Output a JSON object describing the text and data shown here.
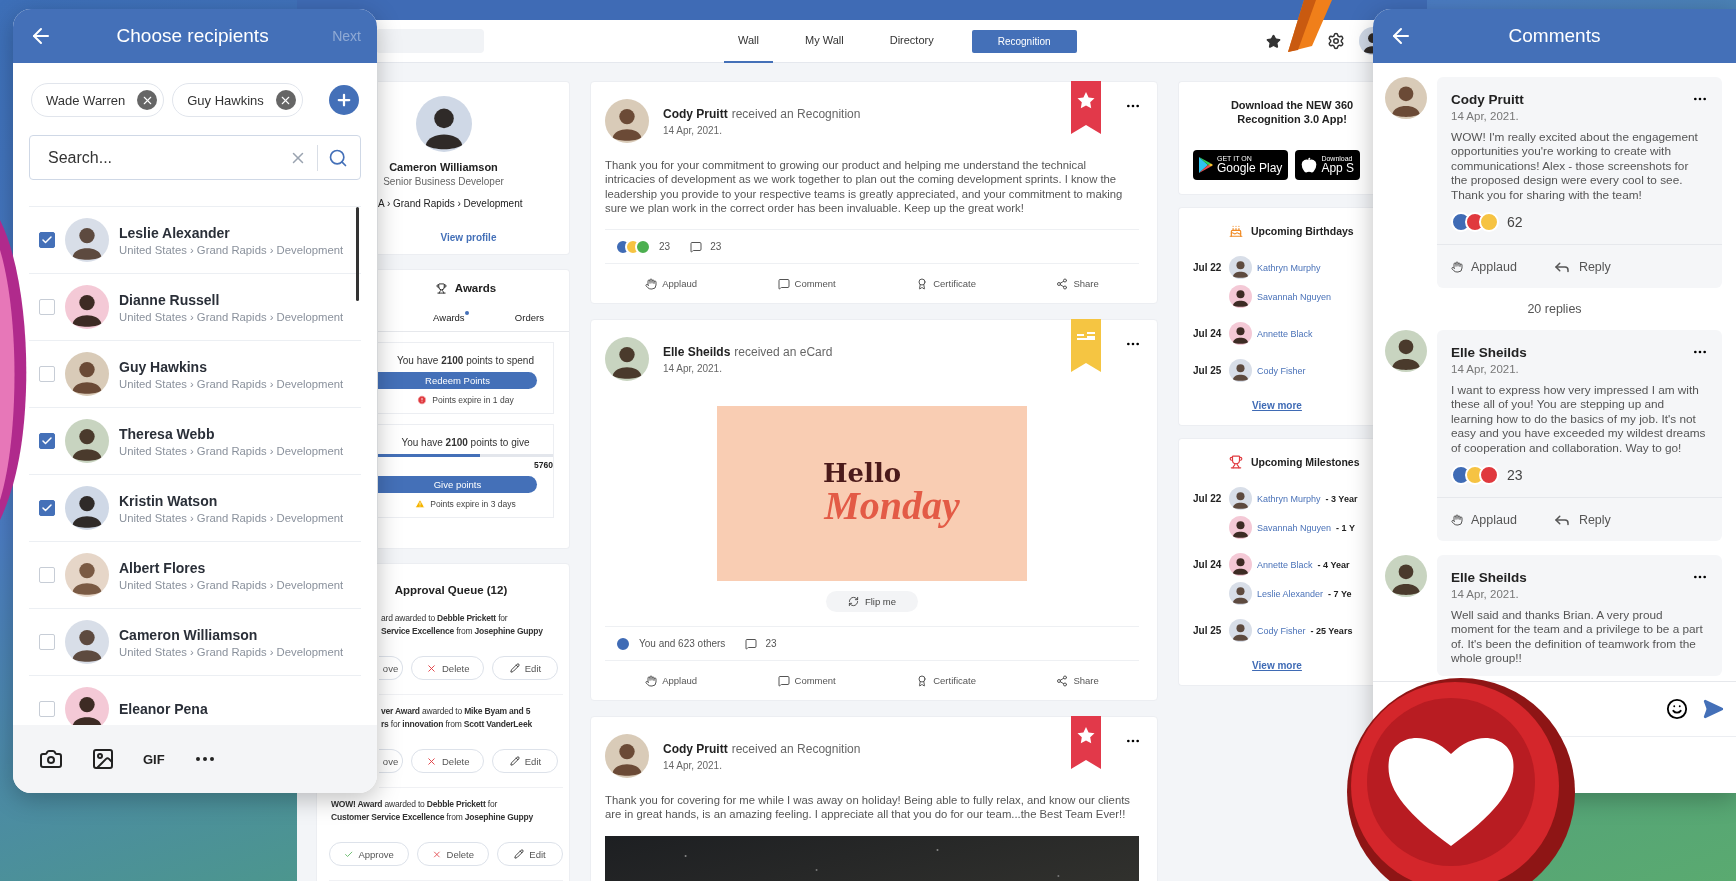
{
  "recipients_panel": {
    "title": "Choose recipients",
    "next": {
      "label": "Next",
      "disabled": true
    },
    "chips": [
      {
        "label": "Wade Warren"
      },
      {
        "label": "Guy Hawkins"
      }
    ],
    "search": {
      "placeholder": "Search..."
    },
    "people": [
      {
        "name": "Leslie Alexander",
        "path": "United States › Grand Rapids › Development",
        "checked": true
      },
      {
        "name": "Dianne Russell",
        "path": "United States › Grand Rapids › Development",
        "checked": false
      },
      {
        "name": "Guy Hawkins",
        "path": "United States › Grand Rapids › Development",
        "checked": false
      },
      {
        "name": "Theresa Webb",
        "path": "United States › Grand Rapids › Development",
        "checked": true
      },
      {
        "name": "Kristin Watson",
        "path": "United States › Grand Rapids › Development",
        "checked": true
      },
      {
        "name": "Albert Flores",
        "path": "United States › Grand Rapids › Development",
        "checked": false
      },
      {
        "name": "Cameron Williamson",
        "path": "United States › Grand Rapids › Development",
        "checked": false
      },
      {
        "name": "Eleanor Pena",
        "checked": false
      }
    ],
    "toolbar": {
      "gif": "GIF"
    }
  },
  "nav": {
    "tabs": [
      {
        "label": "Wall",
        "selected": true
      },
      {
        "label": "My Wall",
        "selected": false
      },
      {
        "label": "Directory",
        "selected": false
      }
    ],
    "cta": "Recognition"
  },
  "profile": {
    "name": "Cameron Williamson",
    "role": "Senior Business Developer",
    "path": "A › Grand Rapids › Development",
    "link": "View profile"
  },
  "awards": {
    "title": "Awards",
    "tabs": [
      {
        "label": "Awards",
        "dot": true,
        "selected": false
      },
      {
        "label": "Orders",
        "selected": false
      }
    ],
    "spend": {
      "text": "You have **2100** points to spend",
      "button": "Redeem Points",
      "note": {
        "kind": "error",
        "text": "Points expire in 1 day"
      }
    },
    "give": {
      "text": "You have **2100** points to give",
      "level": 0.58,
      "total": "5760",
      "button": "Give points",
      "note": {
        "kind": "warning",
        "text": "Points expire in 3 days"
      }
    }
  },
  "approval": {
    "title": "Approval Queue (12)",
    "items": [
      {
        "lines": [
          "ard awarded to **Debble Prickett** for",
          "**Service Excellence** from **Josephine Guppy**"
        ],
        "buttons": [
          {
            "kind": "approve",
            "label": "ove",
            "clipped": true
          },
          {
            "kind": "delete",
            "label": "Delete"
          },
          {
            "kind": "edit",
            "label": "Edit"
          }
        ]
      },
      {
        "lines": [
          "**ver Award** awarded to **Mike Byam and 5**",
          "**rs** for **innovation** from **Scott VanderLeek**"
        ],
        "buttons": [
          {
            "kind": "approve",
            "label": "ove",
            "clipped": true
          },
          {
            "kind": "delete",
            "label": "Delete"
          },
          {
            "kind": "edit",
            "label": "Edit"
          }
        ]
      },
      {
        "lines": [
          "**WOW! Award** awarded to **Debble Prickett** for",
          "**Customer Service Excellence** from **Josephine Guppy**"
        ],
        "buttons": [
          {
            "kind": "approve",
            "label": "Approve",
            "clipped": false
          },
          {
            "kind": "delete",
            "label": "Delete"
          },
          {
            "kind": "edit",
            "label": "Edit"
          }
        ]
      }
    ]
  },
  "posts": [
    {
      "kind": "recognition",
      "author": "Cody Pruitt",
      "action": "received an Recognition",
      "date": "14 Apr, 2021.",
      "text": "Thank you for your commitment to growing our product and helping me understand the technical intricacies of development as we work together to plan out the coming development sprints.  I know the leadership you provide to your respective teams is greatly appreciated, and your commitment to making sure we plan work in the correct order has been invaluable. Keep up the great work!",
      "reactions": [
        {
          "kind": "applaud"
        },
        {
          "kind": "laugh"
        },
        {
          "kind": "clover"
        }
      ],
      "reaction_count": "23",
      "comment_count": "23",
      "actions": [
        {
          "kind": "applaud",
          "label": "Applaud"
        },
        {
          "kind": "comment",
          "label": "Comment"
        },
        {
          "kind": "certificate",
          "label": "Certificate"
        },
        {
          "kind": "share",
          "label": "Share"
        }
      ]
    },
    {
      "kind": "ecard",
      "author": "Elle Sheilds",
      "action": "received an eCard",
      "date": "14 Apr, 2021.",
      "card": {
        "title": "Hello",
        "script": "Monday",
        "flip": "Flip me"
      },
      "reactions": [
        {
          "kind": "applaud"
        }
      ],
      "reaction_count": "You and 623 others",
      "comment_count": "23",
      "actions": [
        {
          "kind": "applaud",
          "label": "Applaud"
        },
        {
          "kind": "comment",
          "label": "Comment"
        },
        {
          "kind": "certificate",
          "label": "Certificate"
        },
        {
          "kind": "share",
          "label": "Share"
        }
      ]
    },
    {
      "kind": "recognition",
      "author": "Cody Pruitt",
      "action": "received an Recognition",
      "date": "14 Apr, 2021.",
      "text": "Thank you for covering for me while I was away on holiday! Being able to fully relax, and know our clients are in great hands, is an amazing feeling. I appreciate all that you do for our team...the Best Team Ever!!"
    }
  ],
  "download": {
    "title": "Download the NEW 360 Recognition 3.0 App!",
    "badges": [
      {
        "kind": "google",
        "small": "GET IT ON",
        "label": "Google Play"
      },
      {
        "kind": "apple",
        "small": "Download",
        "label": "App S"
      }
    ]
  },
  "birthdays": {
    "title": "Upcoming Birthdays",
    "groups": [
      {
        "date": "Jul 22",
        "people": [
          {
            "name": "Kathryn Murphy"
          },
          {
            "name": "Savannah Nguyen"
          }
        ]
      },
      {
        "date": "Jul 24",
        "people": [
          {
            "name": "Annette Black"
          }
        ]
      },
      {
        "date": "Jul 25",
        "people": [
          {
            "name": "Cody Fisher"
          }
        ]
      }
    ],
    "more": "View more"
  },
  "milestones": {
    "title": "Upcoming Milestones",
    "groups": [
      {
        "date": "Jul 22",
        "people": [
          {
            "name": "Kathryn Murphy",
            "years": "- 3 Year"
          },
          {
            "name": "Savannah Nguyen",
            "years": "- 1 Y"
          }
        ]
      },
      {
        "date": "Jul 24",
        "people": [
          {
            "name": "Annette Black",
            "years": "- 4 Year"
          },
          {
            "name": "Leslie Alexander",
            "years": "- 7 Ye"
          }
        ]
      },
      {
        "date": "Jul 25",
        "people": [
          {
            "name": "Cody Fisher",
            "years": "- 25 Years"
          }
        ]
      }
    ],
    "more": "View more"
  },
  "comments_panel": {
    "title": "Comments",
    "items": [
      {
        "author": "Cody Pruitt",
        "date": "14 Apr, 2021.",
        "text": "WOW! I'm really excited about the engagement opportunities you're working to create with communications! Alex - those screenshots for the proposed design were every cool to see. Thank you for sharing with the team!",
        "reactions": [
          {
            "kind": "applaud"
          },
          {
            "kind": "love"
          },
          {
            "kind": "laugh"
          }
        ],
        "count": "62",
        "actions": [
          {
            "kind": "applaud",
            "label": "Applaud"
          },
          {
            "kind": "reply",
            "label": "Reply"
          }
        ],
        "replies": "20 replies"
      },
      {
        "author": "Elle Sheilds",
        "date": "14 Apr, 2021.",
        "text": "I want to express how very impressed I am with these all of you! You are stepping up and learning how to do the basics of my job. It's not easy and you have exceeded my wildest dreams of cooperation and collaboration. Way to go!",
        "reactions": [
          {
            "kind": "applaud"
          },
          {
            "kind": "laugh"
          },
          {
            "kind": "love"
          }
        ],
        "count": "23",
        "actions": [
          {
            "kind": "applaud",
            "label": "Applaud"
          },
          {
            "kind": "reply",
            "label": "Reply"
          }
        ]
      },
      {
        "author": "Elle Sheilds",
        "date": "14 Apr, 2021.",
        "text": "Well said and thanks Brian. A very proud moment for the team and a privilege to be a part of. It's been the definition of teamwork from the whole group!!"
      }
    ]
  }
}
